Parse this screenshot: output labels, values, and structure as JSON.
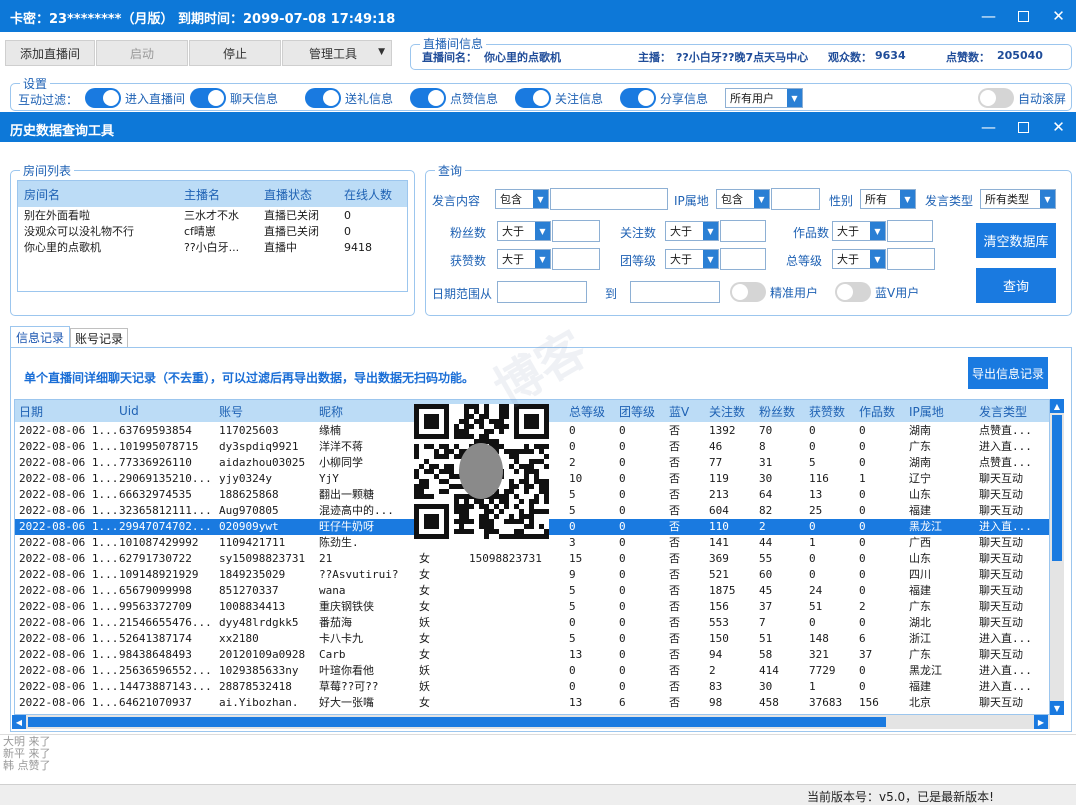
{
  "app": {
    "title": "卡密：23********（月版） 到期时间：2099-07-08 17:49:18"
  },
  "toolbar": {
    "add_room": "添加直播间",
    "start": "启动",
    "stop": "停止",
    "manage_tools": "管理工具"
  },
  "live_info": {
    "group_label": "直播间信息",
    "room_name_label": "直播间名：",
    "room_name": "你心里的点歌机",
    "host_label": "主播：",
    "host": "??小白牙??晚7点天马中心",
    "viewers_label": "观众数：",
    "viewers": "9634",
    "likes_label": "点赞数：",
    "likes": "205040"
  },
  "settings": {
    "group_label": "设置",
    "filter_label": "互动过滤：",
    "toggles": [
      "进入直播间",
      "聊天信息",
      "送礼信息",
      "点赞信息",
      "关注信息",
      "分享信息"
    ],
    "user_filter": "所有用户",
    "auto_scroll": "自动滚屏"
  },
  "history_tool": {
    "title": "历史数据查询工具"
  },
  "room_list": {
    "group_label": "房间列表",
    "columns": [
      "房间名",
      "主播名",
      "直播状态",
      "在线人数"
    ],
    "rows": [
      [
        "别在外面看啦",
        "三水才不水",
        "直播已关闭",
        "0"
      ],
      [
        "没观众可以没礼物不行",
        "cf晴崽",
        "直播已关闭",
        "0"
      ],
      [
        "你心里的点歌机",
        "??小白牙...",
        "直播中",
        "9418"
      ]
    ]
  },
  "query": {
    "group_label": "查询",
    "speech_content_label": "发言内容",
    "speech_mode": "包含",
    "ip_label": "IP属地",
    "ip_mode": "包含",
    "gender_label": "性别",
    "gender_value": "所有",
    "speech_type_label": "发言类型",
    "speech_type_value": "所有类型",
    "fans_label": "粉丝数",
    "follow_label": "关注数",
    "works_label": "作品数",
    "likes_label": "获赞数",
    "group_level_label": "团等级",
    "total_level_label": "总等级",
    "compare_value": "大于",
    "date_from_label": "日期范围从",
    "date_to_label": "到",
    "precise_user": "精准用户",
    "bluev_user": "蓝V用户",
    "clear_db": "清空数据库",
    "search": "查询"
  },
  "tabs": {
    "info": "信息记录",
    "account": "账号记录"
  },
  "records": {
    "notice": "单个直播间详细聊天记录（不去重），可以过滤后再导出数据，导出数据无扫码功能。",
    "export": "导出信息记录",
    "columns": [
      "日期",
      "Uid",
      "账号",
      "昵称",
      "",
      "",
      "总等级",
      "团等级",
      "蓝V",
      "关注数",
      "粉丝数",
      "获赞数",
      "作品数",
      "IP属地",
      "发言类型"
    ],
    "rows": [
      [
        "2022-08-06 1...",
        "63769593854",
        "117025603",
        "缘楠",
        "",
        "",
        "0",
        "0",
        "否",
        "1392",
        "70",
        "0",
        "0",
        "湖南",
        "点赞直..."
      ],
      [
        "2022-08-06 1...",
        "101995078715",
        "dy3spdiq9921",
        "洋洋不蒋",
        "",
        "",
        "0",
        "0",
        "否",
        "46",
        "8",
        "0",
        "0",
        "广东",
        "进入直..."
      ],
      [
        "2022-08-06 1...",
        "77336926110",
        "aidazhou03025",
        "小柳同学",
        "",
        "",
        "2",
        "0",
        "否",
        "77",
        "31",
        "5",
        "0",
        "湖南",
        "点赞直..."
      ],
      [
        "2022-08-06 1...",
        "29069135210...",
        "yjy0324y",
        "YjY",
        "",
        "",
        "10",
        "0",
        "否",
        "119",
        "30",
        "116",
        "1",
        "辽宁",
        "聊天互动"
      ],
      [
        "2022-08-06 1...",
        "66632974535",
        "188625868",
        "翻出一颗糖",
        "",
        "",
        "5",
        "0",
        "否",
        "213",
        "64",
        "13",
        "0",
        "山东",
        "聊天互动"
      ],
      [
        "2022-08-06 1...",
        "32365812111...",
        "Aug970805",
        "混迹高中的...",
        "",
        "",
        "5",
        "0",
        "否",
        "604",
        "82",
        "25",
        "0",
        "福建",
        "聊天互动"
      ],
      [
        "2022-08-06 1...",
        "29947074702...",
        "020909ywt",
        "旺仔牛奶呀",
        "",
        "",
        "0",
        "0",
        "否",
        "110",
        "2",
        "0",
        "0",
        "黑龙江",
        "进入直..."
      ],
      [
        "2022-08-06 1...",
        "101087429992",
        "1109421711",
        "陈劲生.",
        "",
        "",
        "3",
        "0",
        "否",
        "141",
        "44",
        "1",
        "0",
        "广西",
        "聊天互动"
      ],
      [
        "2022-08-06 1...",
        "62791730722",
        "sy15098823731",
        "21",
        "女",
        "15098823731",
        "15",
        "0",
        "否",
        "369",
        "55",
        "0",
        "0",
        "山东",
        "聊天互动"
      ],
      [
        "2022-08-06 1...",
        "109148921929",
        "1849235029",
        "??Asvutirui?",
        "女",
        "",
        "9",
        "0",
        "否",
        "521",
        "60",
        "0",
        "0",
        "四川",
        "聊天互动"
      ],
      [
        "2022-08-06 1...",
        "65679099998",
        "851270337",
        "wana",
        "女",
        "",
        "5",
        "0",
        "否",
        "1875",
        "45",
        "24",
        "0",
        "福建",
        "聊天互动"
      ],
      [
        "2022-08-06 1...",
        "99563372709",
        "1008834413",
        "重庆钢铁侠",
        "女",
        "",
        "5",
        "0",
        "否",
        "156",
        "37",
        "51",
        "2",
        "广东",
        "聊天互动"
      ],
      [
        "2022-08-06 1...",
        "21546655476...",
        "dyy48lrdgkk5",
        "番茄海",
        "妖",
        "",
        "0",
        "0",
        "否",
        "553",
        "7",
        "0",
        "0",
        "湖北",
        "聊天互动"
      ],
      [
        "2022-08-06 1...",
        "52641387174",
        "xx2180",
        "卡八卡九",
        "女",
        "",
        "5",
        "0",
        "否",
        "150",
        "51",
        "148",
        "6",
        "浙江",
        "进入直..."
      ],
      [
        "2022-08-06 1...",
        "98438648493",
        "20120109a0928",
        "Carb",
        "女",
        "",
        "13",
        "0",
        "否",
        "94",
        "58",
        "321",
        "37",
        "广东",
        "聊天互动"
      ],
      [
        "2022-08-06 1...",
        "25636596552...",
        "1029385633ny",
        "叶瑄你看他",
        "妖",
        "",
        "0",
        "0",
        "否",
        "2",
        "414",
        "7729",
        "0",
        "黑龙江",
        "进入直..."
      ],
      [
        "2022-08-06 1...",
        "14473887143...",
        "28878532418",
        "草莓??可??",
        "妖",
        "",
        "0",
        "0",
        "否",
        "83",
        "30",
        "1",
        "0",
        "福建",
        "进入直..."
      ],
      [
        "2022-08-06 1...",
        "64621070937",
        "ai.Yibozhan.",
        "好大一张嘴",
        "女",
        "",
        "13",
        "6",
        "否",
        "98",
        "458",
        "37683",
        "156",
        "北京",
        "聊天互动"
      ]
    ]
  },
  "log": [
    "大明 来了",
    "新平 来了",
    "韩 点赞了"
  ],
  "status": {
    "version": "当前版本号：v5.0，已是最新版本!"
  },
  "watermark": "博客"
}
